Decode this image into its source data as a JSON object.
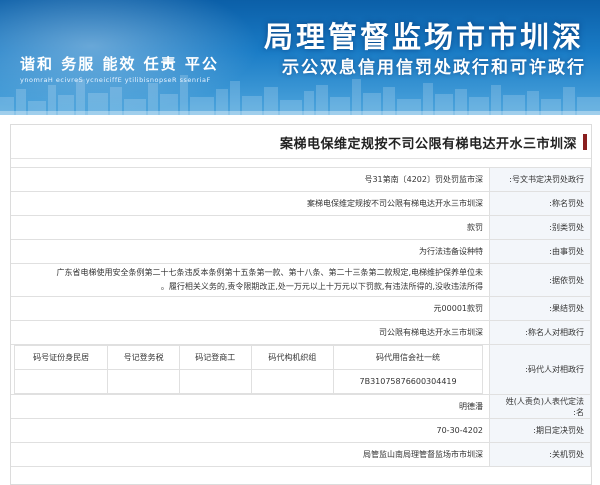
{
  "banner": {
    "title": "深圳市市场监督管理局",
    "subtitle": "行政许可和行政处罚信用信息双公示",
    "motto": "公平 责任 效能 服务 和谐",
    "motto_en": "Fairness Responsibility Efficiency Service Harmony"
  },
  "record_title": "深圳市三水开达电梯有限公司不按规定维保电梯案",
  "rows": [
    {
      "label": "行政处罚决定书文号:",
      "value": "深市监罚处罚〔2024〕南第13号"
    },
    {
      "label": "处罚名称:",
      "value": "深圳市三水开达电梯有限公司不按规定维保电梯案"
    },
    {
      "label": "处罚类别:",
      "value": "罚款"
    },
    {
      "label": "处罚事由:",
      "value": "特种设备违法行为"
    },
    {
      "label": "处罚依据:",
      "value_line1": "广东省电梯使用安全条例第二十七条违反本条例第十五条第一款、第十八条、第二十三条第二款规定,电梯维护保养单位未",
      "value_line2": "履行相关义务的,责令限期改正,处一万元以上十万元以下罚款,有违法所得的,没收违法所得。"
    },
    {
      "label": "处罚结果:",
      "value": "罚款10000元"
    },
    {
      "label": "行政相对人名称:",
      "value": "深圳市三水开达电梯有限公司"
    }
  ],
  "ids": {
    "label": "行政相对人代码:",
    "headers": [
      "统一社会信用代码",
      "组织机构代码",
      "工商登记码",
      "税务登记号",
      "居民身份证号码"
    ],
    "values": [
      "91440300667857013B7",
      "",
      "",
      "",
      ""
    ]
  },
  "rows2": [
    {
      "label": "法定代表人(负责人)姓名:",
      "value": "潘德明"
    },
    {
      "label": "处罚决定日期:",
      "value": "2024-03-07"
    },
    {
      "label": "处罚机关:",
      "value": "深圳市市场监督管理局南山监管局"
    }
  ]
}
